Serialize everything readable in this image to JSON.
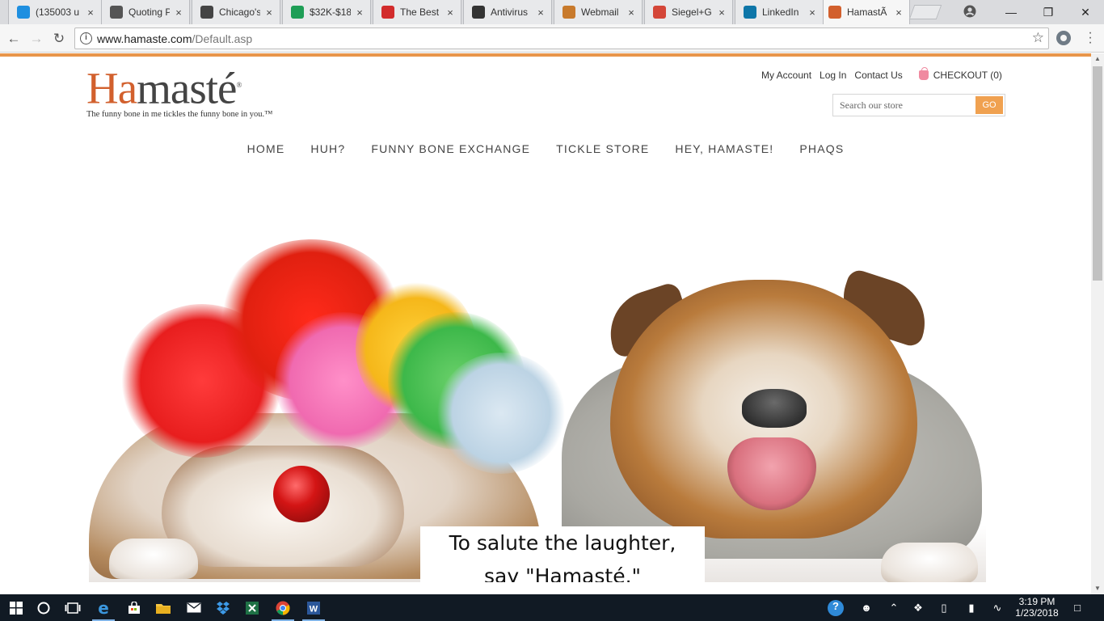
{
  "browser": {
    "tabs": [
      {
        "title": "(135003 u",
        "favicon": "att-globe-icon",
        "color": "#1e8fe0"
      },
      {
        "title": "Quoting P",
        "favicon": "pushpin-icon",
        "color": "#555555"
      },
      {
        "title": "Chicago's",
        "favicon": "c-letter-icon",
        "color": "#444444"
      },
      {
        "title": "$32K-$18",
        "favicon": "sheet-icon",
        "color": "#1e9e56"
      },
      {
        "title": "The Best C",
        "favicon": "pc-logo-icon",
        "color": "#d22c2c"
      },
      {
        "title": "Antivirus",
        "favicon": "shield-logo-icon",
        "color": "#333333"
      },
      {
        "title": "Webmail",
        "favicon": "leaf-icon",
        "color": "#c87a2c"
      },
      {
        "title": "Siegel+G",
        "favicon": "gmail-icon",
        "color": "#d44638"
      },
      {
        "title": "LinkedIn",
        "favicon": "linkedin-icon",
        "color": "#0e76a8"
      },
      {
        "title": "HamastÃ",
        "favicon": "hamaste-icon",
        "color": "#d2602d"
      }
    ],
    "url_host": "www.hamaste.com",
    "url_path": "/Default.asp"
  },
  "site": {
    "logo_word_prefix": "Ha",
    "logo_word_rest": "masté",
    "logo_mark": "®",
    "tagline": "The funny bone in me tickles the funny bone in you.™",
    "util_links": [
      "My Account",
      "Log In",
      "Contact Us"
    ],
    "checkout_label": "CHECKOUT (0)",
    "search_placeholder": "Search our store",
    "search_button": "GO",
    "nav": [
      "HOME",
      "HUH?",
      "FUNNY BONE EXCHANGE",
      "TICKLE STORE",
      "HEY, HAMASTE!",
      "PHAQS"
    ],
    "hero_caption_line1": "To salute the laughter,",
    "hero_caption_line2": "say \"Hamasté.\""
  },
  "colors": {
    "brand_orange": "#d2602d",
    "accent_bar": "#e8954a",
    "go_button": "#f0a150"
  },
  "taskbar": {
    "items": [
      "windows-start-icon",
      "cortana-icon",
      "task-view-icon",
      "edge-icon",
      "store-icon",
      "file-explorer-icon",
      "mail-icon",
      "dropbox-icon",
      "excel-icon",
      "chrome-icon",
      "word-icon"
    ],
    "time": "3:19 PM",
    "date": "1/23/2018"
  }
}
